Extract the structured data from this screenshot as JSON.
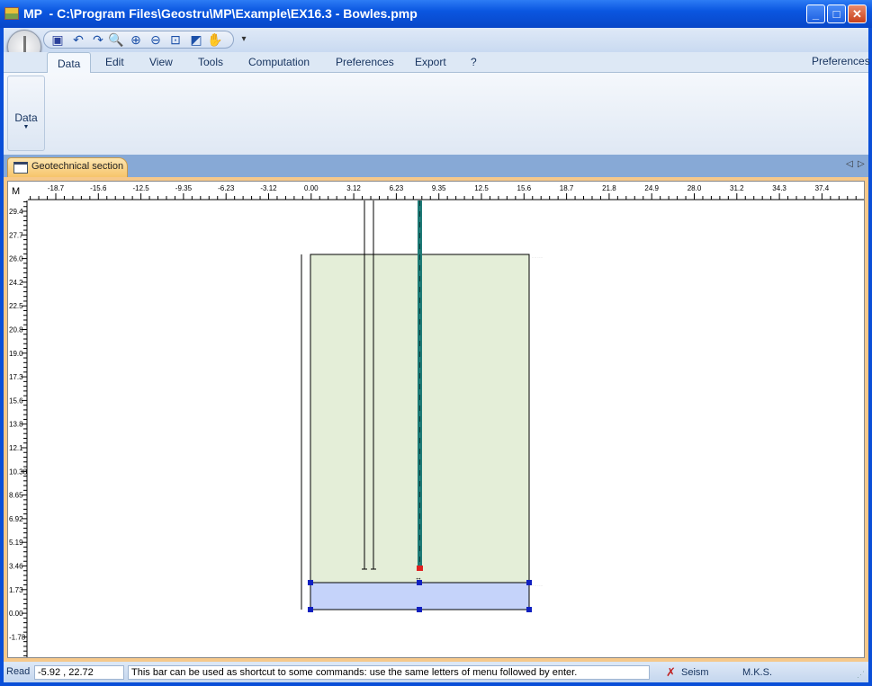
{
  "window": {
    "title": "MP  - C:\\Program Files\\Geostru\\MP\\Example\\EX16.3 - Bowles.pmp",
    "buttons": [
      "minimize",
      "maximize",
      "close"
    ]
  },
  "quick_access": [
    {
      "icon": "save-icon"
    },
    {
      "icon": "undo-icon"
    },
    {
      "icon": "redo-icon"
    },
    {
      "icon": "zoom-page-icon"
    },
    {
      "icon": "zoom-in-icon"
    },
    {
      "icon": "zoom-out-icon"
    },
    {
      "icon": "zoom-window-icon"
    },
    {
      "icon": "zoom-previous-icon"
    },
    {
      "icon": "pan-hand-icon"
    }
  ],
  "ribbon": {
    "tabs": [
      "Data",
      "Edit",
      "View",
      "Tools",
      "Computation",
      "Preferences",
      "Export",
      "?"
    ],
    "active_tab": "Data",
    "right_label": "Preferences",
    "groups": [
      {
        "label": "Data"
      }
    ]
  },
  "document_tab": {
    "label": "Geotechnical section"
  },
  "rulers": {
    "unit": "M",
    "x_labels": [
      "-18.7",
      "-15.6",
      "-12.5",
      "-9.35",
      "-6.23",
      "-3.12",
      "0.00",
      "3.12",
      "6.23",
      "9.35",
      "12.5",
      "15.6",
      "18.7",
      "21.8",
      "24.9",
      "28.0",
      "31.2",
      "34.3",
      "37.4"
    ],
    "y_labels": [
      "29.4",
      "27.7",
      "26.0",
      "24.2",
      "22.5",
      "20.8",
      "19.0",
      "17.3",
      "15.6",
      "13.8",
      "12.1",
      "10.38",
      "8.65",
      "6.92",
      "5.19",
      "3.46",
      "1.73",
      "0.00",
      "-1.73"
    ]
  },
  "drawing": {
    "colors": {
      "layer1": "#e4eed8",
      "layer2": "#c5d3fa",
      "pile": "#1e7a76",
      "pile_tip": "#e02020",
      "node": "#1020c0"
    }
  },
  "status": {
    "mode": "Read",
    "coordinates": "-5.92 , 22.72",
    "command_hint": "This bar can be used as shortcut to some commands: use the same letters of menu followed by enter.",
    "seism_label": "Seism",
    "units": "M.K.S."
  }
}
